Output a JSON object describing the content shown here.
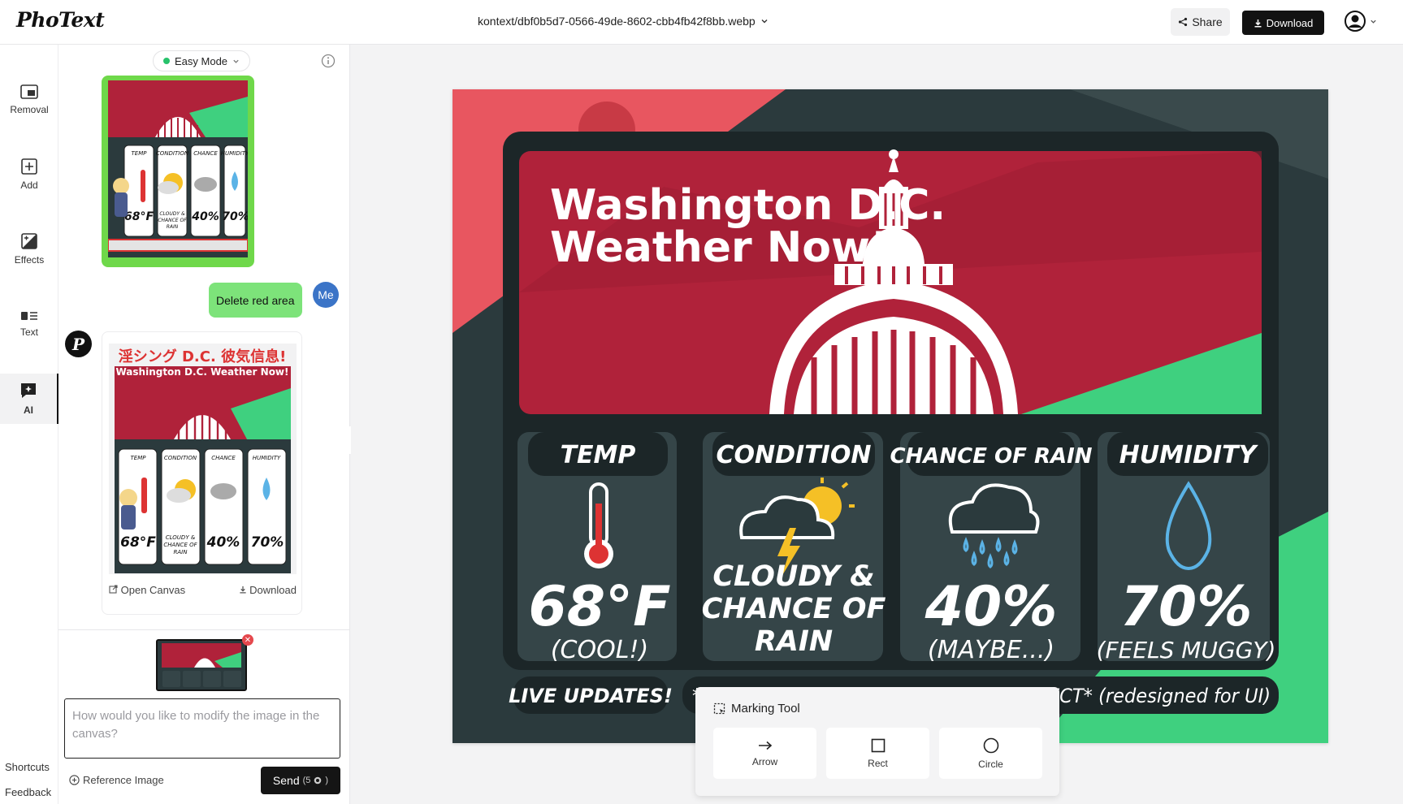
{
  "app": {
    "logo": "PhoText",
    "filename": "kontext/dbf0b5d7-0566-49de-8602-cbb4fb42f8bb.webp"
  },
  "header": {
    "share_label": "Share",
    "download_label": "Download"
  },
  "rail": {
    "items": [
      {
        "label": "Removal",
        "icon": "removal-icon"
      },
      {
        "label": "Add",
        "icon": "add-icon"
      },
      {
        "label": "Effects",
        "icon": "effects-icon"
      },
      {
        "label": "Text",
        "icon": "text-icon"
      },
      {
        "label": "AI",
        "icon": "ai-icon",
        "active": true
      }
    ],
    "shortcuts_label": "Shortcuts",
    "feedback_label": "Feedback"
  },
  "chat": {
    "mode_label": "Easy Mode",
    "user_message": "Delete red area",
    "user_badge": "Me",
    "open_canvas_label": "Open Canvas",
    "card_download_label": "Download",
    "prompt_placeholder": "How would you like to modify the image in the canvas?",
    "reference_image_label": "Reference Image",
    "send_label": "Send",
    "send_cost": "(5"
  },
  "artwork": {
    "title_line1": "Washington D.C.",
    "title_line2": "Weather Now!",
    "cards": [
      {
        "header": "TEMP",
        "value": "68°F",
        "sub": "(COOL!)",
        "icon": "thermometer-icon"
      },
      {
        "header": "CONDITION",
        "value_lines": [
          "CLOUDY &",
          "CHANCE OF",
          "RAIN"
        ],
        "icon": "storm-cloud-icon"
      },
      {
        "header": "CHANCE OF RAIN",
        "value": "40%",
        "sub": "(MAYBE...)",
        "icon": "rain-cloud-icon"
      },
      {
        "header": "HUMIDITY",
        "value": "70%",
        "sub": "(FEELS MUGGY)",
        "icon": "droplet-icon"
      }
    ],
    "live_label": "LIVE UPDATES!",
    "footer_text": "*DATA IS SIMULATED FOR POP ART EFFECT* (redesigned for UI)",
    "thumb_title_jp": "淫シング D.C. 彼気信息!",
    "thumb_title_en": "Washington D.C. Weather Now!"
  },
  "marking_tool": {
    "title": "Marking Tool",
    "tools": [
      {
        "label": "Arrow",
        "icon": "arrow-icon"
      },
      {
        "label": "Rect",
        "icon": "rect-icon"
      },
      {
        "label": "Circle",
        "icon": "circle-icon"
      }
    ]
  },
  "colors": {
    "crimson": "#b0223a",
    "mint": "#3fd07f",
    "slate": "#2b3a3d",
    "accent_blue": "#3b74c7"
  }
}
